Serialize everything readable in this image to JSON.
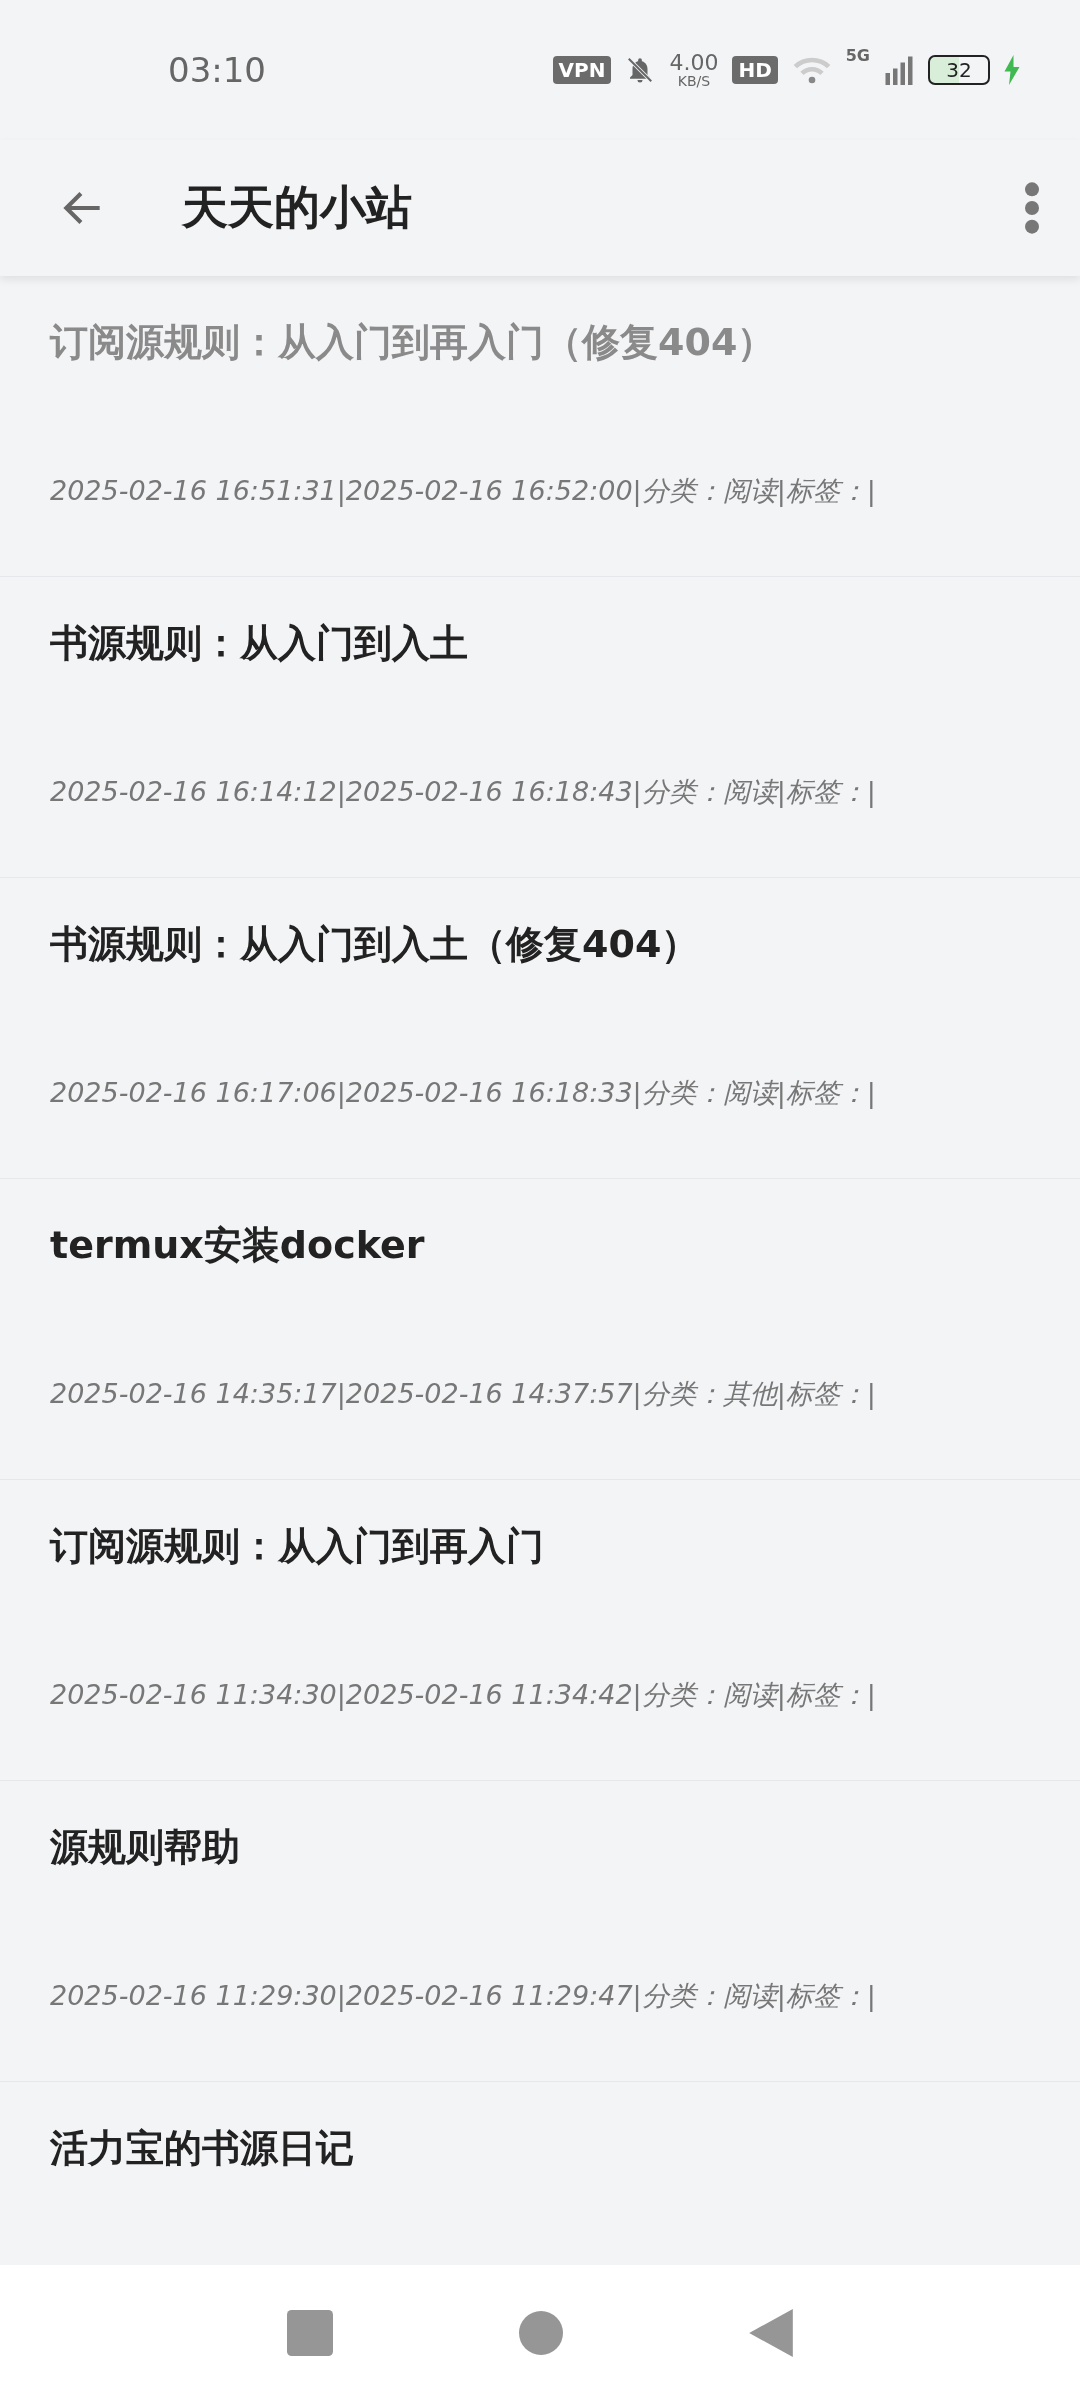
{
  "status_bar": {
    "time": "03:10",
    "vpn": "VPN",
    "speed": "4.00",
    "speed_unit": "KB/S",
    "hd": "HD",
    "network": "5G",
    "battery": "32",
    "charging": true
  },
  "app_bar": {
    "title": "天天的小站"
  },
  "articles": [
    {
      "title": "订阅源规则：从入门到再入门（修复404）",
      "meta": "2025-02-16 16:51:31|2025-02-16 16:52:00|分类：阅读|标签：|",
      "visited": true
    },
    {
      "title": "书源规则：从入门到入土",
      "meta": "2025-02-16 16:14:12|2025-02-16 16:18:43|分类：阅读|标签：|",
      "visited": false
    },
    {
      "title": "书源规则：从入门到入土（修复404）",
      "meta": "2025-02-16 16:17:06|2025-02-16 16:18:33|分类：阅读|标签：|",
      "visited": false
    },
    {
      "title": "termux安装docker",
      "meta": "2025-02-16 14:35:17|2025-02-16 14:37:57|分类：其他|标签：|",
      "visited": false
    },
    {
      "title": "订阅源规则：从入门到再入门",
      "meta": "2025-02-16 11:34:30|2025-02-16 11:34:42|分类：阅读|标签：|",
      "visited": false
    },
    {
      "title": "源规则帮助",
      "meta": "2025-02-16 11:29:30|2025-02-16 11:29:47|分类：阅读|标签：|",
      "visited": false
    },
    {
      "title": "活力宝的书源日记",
      "visited": false
    }
  ]
}
